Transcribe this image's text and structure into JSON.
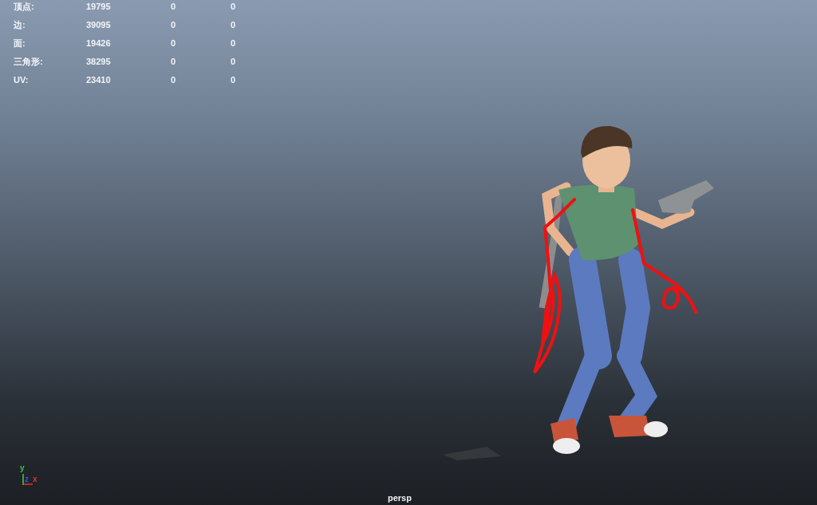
{
  "stats": {
    "rows": [
      {
        "label": "顶点:",
        "values": [
          "19795",
          "0",
          "0"
        ]
      },
      {
        "label": "边:",
        "values": [
          "39095",
          "0",
          "0"
        ]
      },
      {
        "label": "面:",
        "values": [
          "19426",
          "0",
          "0"
        ]
      },
      {
        "label": "三角形:",
        "values": [
          "38295",
          "0",
          "0"
        ]
      },
      {
        "label": "UV:",
        "values": [
          "23410",
          "0",
          "0"
        ]
      }
    ]
  },
  "axis": {
    "labels": [
      "y",
      "z",
      "x"
    ]
  },
  "camera": "persp"
}
